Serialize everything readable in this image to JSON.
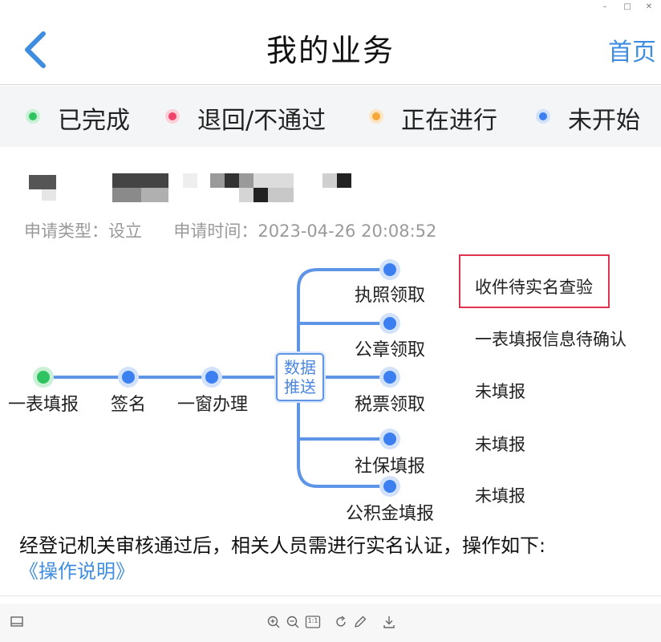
{
  "window": {
    "minimize": "–",
    "maximize": "□",
    "close": "✕"
  },
  "navbar": {
    "title": "我的业务",
    "home_label": "首页"
  },
  "legend": [
    {
      "label": "已完成",
      "color": "#2fc361"
    },
    {
      "label": "退回/不通过",
      "color": "#f0436a"
    },
    {
      "label": "正在进行",
      "color": "#f6a83a"
    },
    {
      "label": "未开始",
      "color": "#3c7ff0"
    }
  ],
  "application": {
    "type_text": "申请类型：设立",
    "time_text": "申请时间：2023-04-26 20:08:52"
  },
  "flow": {
    "main_steps": [
      {
        "label": "一表填报",
        "state": "completed"
      },
      {
        "label": "签名",
        "state": "not-started"
      },
      {
        "label": "一窗办理",
        "state": "not-started"
      }
    ],
    "hub_label": "数据推送",
    "branches": [
      {
        "label": "执照领取",
        "status": "收件待实名查验",
        "highlighted": true
      },
      {
        "label": "公章领取",
        "status": "一表填报信息待确认"
      },
      {
        "label": "税票领取",
        "status": "未填报"
      },
      {
        "label": "社保填报",
        "status": "未填报"
      },
      {
        "label": "公积金填报",
        "status": "未填报"
      }
    ]
  },
  "note": {
    "text": "经登记机关审核通过后，相关人员需进行实名认证，操作如下:",
    "link_label": "《操作说明》"
  },
  "toolbar": {
    "page_badge": "1:1"
  },
  "colors": {
    "accent": "#3f8de0",
    "flow_line": "#5f95e6",
    "highlight_border": "#e0334f"
  }
}
